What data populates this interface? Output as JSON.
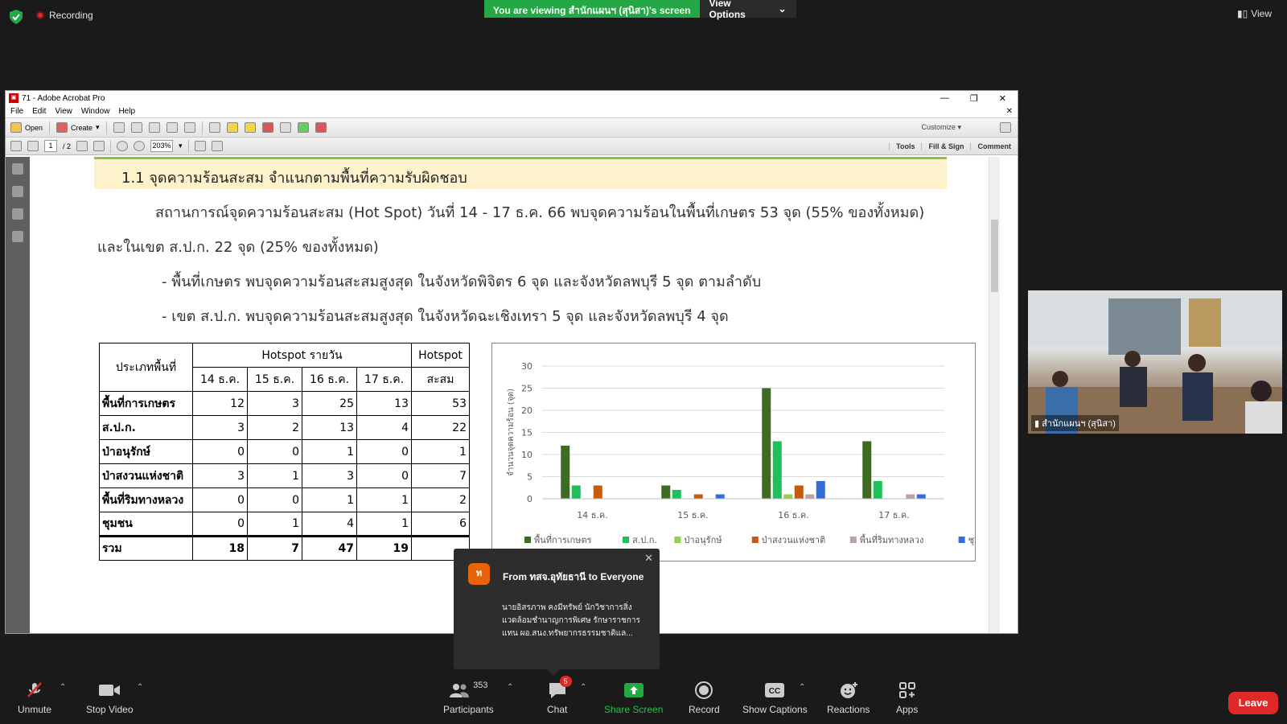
{
  "zoom": {
    "recording_label": "Recording",
    "banner_text": "You are viewing สำนักแผนฯ (สุนิสา)'s screen",
    "view_options_label": "View Options",
    "view_label": "View",
    "participant_name": "สำนักแผนฯ (สุนิสา)",
    "toolbar": {
      "unmute": "Unmute",
      "stop_video": "Stop Video",
      "participants": "Participants",
      "participants_count": "353",
      "chat": "Chat",
      "chat_badge": "5",
      "share_screen": "Share Screen",
      "record": "Record",
      "show_captions": "Show Captions",
      "reactions": "Reactions",
      "apps": "Apps",
      "leave": "Leave"
    },
    "chat_toast": {
      "avatar_letter": "ท",
      "from": "From ทสจ.อุทัยธานี to Everyone",
      "message": "นายอิสรภาพ คงมีทรัพย์ นักวิชาการสิ่งแวดล้อมชำนาญการพิเศษ รักษาราชการแทน ผอ.สนง.ทรัพยากรธรรมชาติแล..."
    }
  },
  "acrobat": {
    "window_title": "71 - Adobe Acrobat Pro",
    "menu": [
      "File",
      "Edit",
      "View",
      "Window",
      "Help"
    ],
    "open_label": "Open",
    "create_label": "Create",
    "customize_label": "Customize",
    "page_current": "1",
    "page_total": "/ 2",
    "zoom_level": "203%",
    "tools_label": "Tools",
    "fill_sign_label": "Fill & Sign",
    "comment_label": "Comment"
  },
  "document": {
    "section_heading": "1.1 จุดความร้อนสะสม จำแนกตามพื้นที่ความรับผิดชอบ",
    "para1_line1": "สถานการณ์จุดความร้อนสะสม (Hot Spot) วันที่ 14 - 17 ธ.ค. 66 พบจุดความร้อนในพื้นที่เกษตร 53 จุด (55% ของทั้งหมด)",
    "para1_line2": "และในเขต ส.ป.ก. 22 จุด (25% ของทั้งหมด)",
    "bullet1": "- พื้นที่เกษตร พบจุดความร้อนสะสมสูงสุด ในจังหวัดพิจิตร 6 จุด และจังหวัดลพบุรี 5 จุด ตามลำดับ",
    "bullet2": "- เขต ส.ป.ก. พบจุดความร้อนสะสมสูงสุด ในจังหวัดฉะเชิงเทรา 5 จุด และจังหวัดลพบุรี 4 จุด",
    "table": {
      "area_header": "ประเภทพื้นที่",
      "daily_header": "Hotspot รายวัน",
      "cum_header_1": "Hotspot",
      "cum_header_2": "สะสม",
      "days": [
        "14 ธ.ค.",
        "15 ธ.ค.",
        "16 ธ.ค.",
        "17 ธ.ค."
      ],
      "rows": [
        {
          "label": "พื้นที่การเกษตร",
          "values": [
            "12",
            "3",
            "25",
            "13",
            "53"
          ]
        },
        {
          "label": "ส.ป.ก.",
          "values": [
            "3",
            "2",
            "13",
            "4",
            "22"
          ]
        },
        {
          "label": "ป่าอนุรักษ์",
          "values": [
            "0",
            "0",
            "1",
            "0",
            "1"
          ]
        },
        {
          "label": "ป่าสงวนแห่งชาติ",
          "values": [
            "3",
            "1",
            "3",
            "0",
            "7"
          ]
        },
        {
          "label": "พื้นที่ริมทางหลวง",
          "values": [
            "0",
            "0",
            "1",
            "1",
            "2"
          ]
        },
        {
          "label": "ชุมชน",
          "values": [
            "0",
            "1",
            "4",
            "1",
            "6"
          ]
        }
      ],
      "total": {
        "label": "รวม",
        "values": [
          "18",
          "7",
          "47",
          "19",
          ""
        ]
      }
    }
  },
  "chart_data": {
    "type": "bar",
    "categories": [
      "14 ธ.ค.",
      "15 ธ.ค.",
      "16 ธ.ค.",
      "17 ธ.ค."
    ],
    "ylabel": "จำนวนจุดความร้อน (จุด)",
    "ylim": [
      0,
      30
    ],
    "yticks": [
      "0",
      "5",
      "10",
      "15",
      "20",
      "25",
      "30"
    ],
    "grid": true,
    "legend_placement": "bottom",
    "series": [
      {
        "name": "พื้นที่การเกษตร",
        "color": "#3d6b21",
        "values": [
          12,
          3,
          25,
          13
        ]
      },
      {
        "name": "ส.ป.ก.",
        "color": "#1fbf5a",
        "values": [
          3,
          2,
          13,
          4
        ]
      },
      {
        "name": "ป่าอนุรักษ์",
        "color": "#92d050",
        "values": [
          0,
          0,
          1,
          0
        ]
      },
      {
        "name": "ป่าสงวนแห่งชาติ",
        "color": "#c55a11",
        "values": [
          3,
          1,
          3,
          0
        ]
      },
      {
        "name": "พื้นที่ริมทางหลวง",
        "color": "#b7a3a8",
        "values": [
          0,
          0,
          1,
          1
        ]
      },
      {
        "name": "ชุมชน",
        "color": "#2f6fd6",
        "values": [
          0,
          1,
          4,
          1
        ]
      }
    ]
  }
}
